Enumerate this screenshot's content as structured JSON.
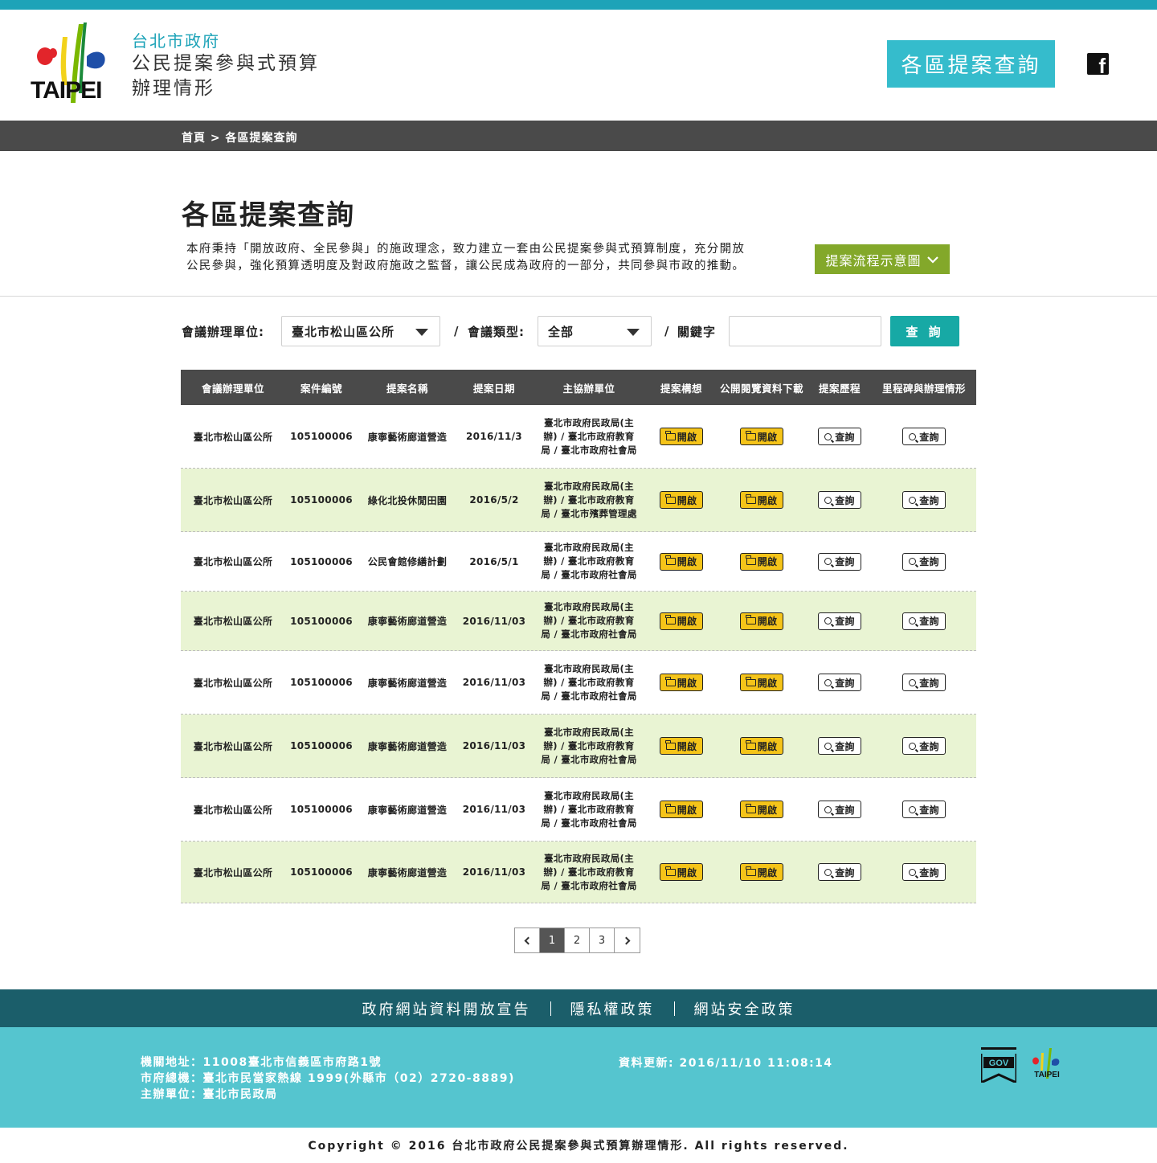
{
  "header": {
    "logo_text": "TAIPEI",
    "brand_line1": "台北市政府",
    "brand_line2": "公民提案參與式預算",
    "brand_line3": "辦理情形",
    "nav_button": "各區提案查詢",
    "facebook_glyph": "f"
  },
  "breadcrumb": "首頁 > 各區提案查詢",
  "page": {
    "title": "各區提案查詢",
    "intro_line1": "本府秉持「開放政府、全民參與」的施政理念，致力建立一套由公民提案參與式預算制度，充分開放",
    "intro_line2": "公民參與，強化預算透明度及對政府施政之監督，讓公民成為政府的一部分，共同參與市政的推動。",
    "flow_button": "提案流程示意圖"
  },
  "filter": {
    "unit_label": "會議辦理單位:",
    "unit_value": "臺北市松山區公所",
    "sep1": "/",
    "type_label": "會議類型:",
    "type_value": "全部",
    "sep2": "/",
    "keyword_label": "關鍵字",
    "keyword_value": "",
    "search_button": "查 詢"
  },
  "table": {
    "headers": [
      "會議辦理單位",
      "案件編號",
      "提案名稱",
      "提案日期",
      "主協辦單位",
      "提案構想",
      "公開閱覽資料下載",
      "提案歷程",
      "里程碑與辦理情形"
    ],
    "open_label": "開啟",
    "query_label": "查詢",
    "rows": [
      {
        "unit": "臺北市松山區公所",
        "id": "105100006",
        "name": "康寧藝術廊道營造",
        "date": "2016/11/3",
        "org1": "臺北市政府民政局(主",
        "org2": "辦) / 臺北市政府教育",
        "org3": "局 / 臺北市政府社會局"
      },
      {
        "unit": "臺北市松山區公所",
        "id": "105100006",
        "name": "綠化北投休閒田園",
        "date": "2016/5/2",
        "org1": "臺北市政府民政局(主",
        "org2": "辦) / 臺北市政府教育",
        "org3": "局 / 臺北市殯葬管理處"
      },
      {
        "unit": "臺北市松山區公所",
        "id": "105100006",
        "name": "公民會館修繕計劃",
        "date": "2016/5/1",
        "org1": "臺北市政府民政局(主",
        "org2": "辦) / 臺北市政府教育",
        "org3": "局 / 臺北市政府社會局"
      },
      {
        "unit": "臺北市松山區公所",
        "id": "105100006",
        "name": "康寧藝術廊道營造",
        "date": "2016/11/03",
        "org1": "臺北市政府民政局(主",
        "org2": "辦) / 臺北市政府教育",
        "org3": "局 / 臺北市政府社會局"
      },
      {
        "unit": "臺北市松山區公所",
        "id": "105100006",
        "name": "康寧藝術廊道營造",
        "date": "2016/11/03",
        "org1": "臺北市政府民政局(主",
        "org2": "辦) / 臺北市政府教育",
        "org3": "局 / 臺北市政府社會局"
      },
      {
        "unit": "臺北市松山區公所",
        "id": "105100006",
        "name": "康寧藝術廊道營造",
        "date": "2016/11/03",
        "org1": "臺北市政府民政局(主",
        "org2": "辦) / 臺北市政府教育",
        "org3": "局 / 臺北市政府社會局"
      },
      {
        "unit": "臺北市松山區公所",
        "id": "105100006",
        "name": "康寧藝術廊道營造",
        "date": "2016/11/03",
        "org1": "臺北市政府民政局(主",
        "org2": "辦) / 臺北市政府教育",
        "org3": "局 / 臺北市政府社會局"
      },
      {
        "unit": "臺北市松山區公所",
        "id": "105100006",
        "name": "康寧藝術廊道營造",
        "date": "2016/11/03",
        "org1": "臺北市政府民政局(主",
        "org2": "辦) / 臺北市政府教育",
        "org3": "局 / 臺北市政府社會局"
      }
    ]
  },
  "pagination": {
    "pages": [
      "1",
      "2",
      "3"
    ],
    "current": "1"
  },
  "footer": {
    "links": [
      "政府網站資料開放宣告",
      "隱私權政策",
      "網站安全政策"
    ],
    "address": "機關地址：11008臺北市信義區市府路1號",
    "phone": "市府總機：臺北市民當家熱線 1999(外縣市（02）2720-8889)",
    "organizer": "主辦單位：臺北市民政局",
    "updated": "資料更新: 2016/11/10 11:08:14",
    "gov_badge": "GOV",
    "mini_logo_text": "TAIPEI",
    "copyright": "Copyright © 2016 台北市政府公民提案參與式預算辦理情形. All rights reserved."
  },
  "colors": {
    "accent": "#1da3b8",
    "nav_button": "#35bccc",
    "flow_button": "#83a82a",
    "search_button": "#17a9a5",
    "row_alt": "#e9f4d3",
    "open_button": "#f5c419",
    "footer_dark": "#1b5e6a",
    "footer_light": "#55c5cf"
  },
  "icons": [
    "taipei-logo-icon",
    "facebook-icon",
    "chevron-down-icon",
    "caret-down-icon",
    "folder-icon",
    "search-icon",
    "chevron-left-icon",
    "chevron-right-icon",
    "gov-badge-icon"
  ]
}
